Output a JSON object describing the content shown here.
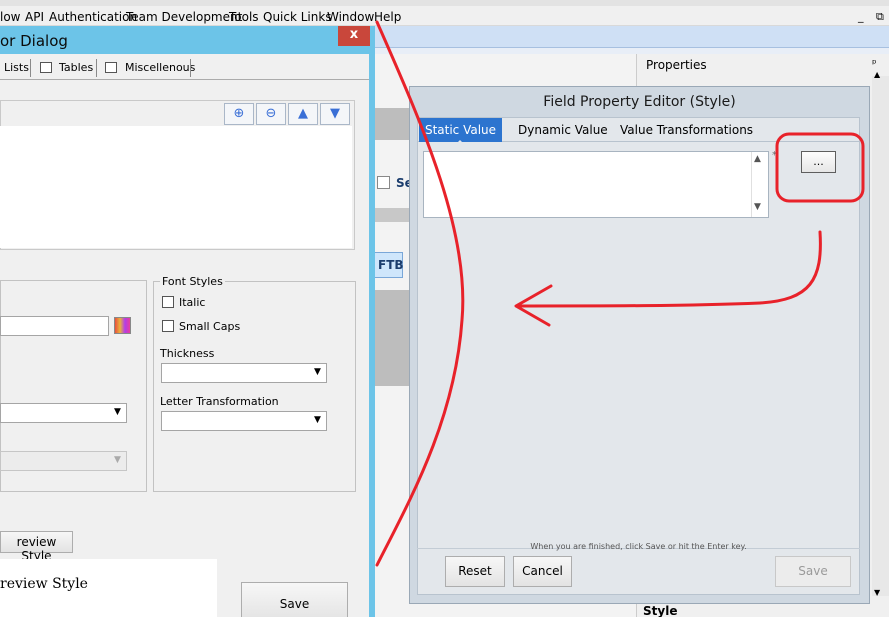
{
  "menu": {
    "items": [
      "low",
      "API",
      "Authentication",
      "Team Development",
      "Tools",
      "Quick Links",
      "Window",
      "Help"
    ],
    "minimize": "_",
    "restore": "⧉"
  },
  "left_dialog": {
    "title": "or Dialog",
    "close": "x",
    "tabs": [
      "Lists",
      "Tables",
      "Miscellenous"
    ],
    "toolbar": [
      "add",
      "remove",
      "up",
      "down"
    ],
    "font_styles": {
      "title": "Font Styles",
      "italic": "Italic",
      "small_caps": "Small Caps",
      "thickness": "Thickness",
      "letter_transformation": "Letter Transformation"
    },
    "preview_button": "review Style",
    "preview_text": "review Style",
    "save": "Save"
  },
  "ide": {
    "se": "Se",
    "ftb": "FTB"
  },
  "properties": {
    "title": "Properties",
    "pin": "ᵖ",
    "style_label": "Style"
  },
  "field_property_editor": {
    "title": "Field Property Editor (Style)",
    "tabs": [
      "Static Value",
      "Dynamic Value",
      "Value Transformations"
    ],
    "active_tab": "Static Value",
    "value": "",
    "ellipsis": "...",
    "marker": "*",
    "hint": "When you are finished, click Save or hit the Enter key.",
    "reset": "Reset",
    "cancel": "Cancel",
    "save": "Save"
  },
  "colors": {
    "annotation": "#e8222a",
    "active_tab": "#2c74cf",
    "dialog_border": "#6cc4e8",
    "close_button": "#c9473b"
  }
}
